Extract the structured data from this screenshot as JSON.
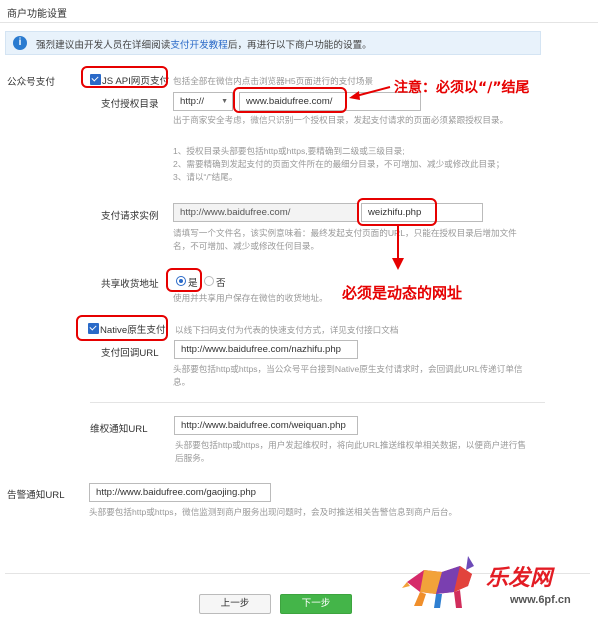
{
  "page_title": "商户功能设置",
  "notice": {
    "before": "强烈建议由开发人员在详细阅读",
    "link": "支付开发教程",
    "after": "后，再进行以下商户功能的设置。"
  },
  "section_public": "公众号支付",
  "jsapi": {
    "label": "JS API网页支付",
    "desc": "包括全部在微信内点击浏览器H5页面进行的支付场景",
    "auth_dir_label": "支付授权目录",
    "protocol": "http://",
    "auth_dir_value": "www.baidufree.com/",
    "auth_hint_1": "出于商家安全考虑，微信只识别一个授权目录，发起支付请求的页面必须紧跟授权目录。",
    "auth_hint_2": "1、授权目录头部要包括http或https,要精确到二级或三级目录;",
    "auth_hint_3": "2、需要精确到发起支付的页面文件所在的最细分目录，不可增加、减少或修改此目录；",
    "auth_hint_4": "3、请以“/”结尾。",
    "req_label": "支付请求实例",
    "req_prefix": "http://www.baidufree.com/",
    "req_file": "weizhifu.php",
    "req_hint_1": "请填写一个文件名，该实例意味着：最终发起支付页面的URL，只能在授权目录后增加文件",
    "req_hint_2": "名，不可增加、减少或修改任何目录。",
    "share_label": "共享收货地址",
    "yes": "是",
    "no": "否",
    "share_hint": "使用并共享用户保存在微信的收货地址。"
  },
  "native": {
    "label": "Native原生支付",
    "desc": "以线下扫码支付为代表的快速支付方式，详见支付接口文档",
    "callback_label": "支付回调URL",
    "callback_value": "http://www.baidufree.com/nazhifu.php",
    "hint_1": "头部要包括http或https，当公众号平台接到Native原生支付请求时，会回调此URL传递订单信",
    "hint_2": "息。"
  },
  "rights": {
    "label": "维权通知URL",
    "value": "http://www.baidufree.com/weiquan.php",
    "hint_1": "头部要包括http或https，用户发起维权时，将向此URL推送维权单相关数据，以便商户进行售",
    "hint_2": "后服务。"
  },
  "alert": {
    "label": "告警通知URL",
    "value": "http://www.baidufree.com/gaojing.php",
    "hint": "头部要包括http或https，微信监测到商户服务出现问题时，会及时推送相关告警信息到商户后台。"
  },
  "annotations": {
    "note_1": "注意：必须以“/”结尾",
    "note_2": "必须是动态的网址"
  },
  "buttons": {
    "prev": "上一步",
    "next": "下一步"
  },
  "watermark": {
    "brand": "乐发网",
    "url": "www.6pf.cn"
  },
  "colors": {
    "accent_red": "#e60000",
    "primary_green": "#44b549",
    "link_blue": "#2a6ac8",
    "notice_bg": "#e8f2fb"
  }
}
